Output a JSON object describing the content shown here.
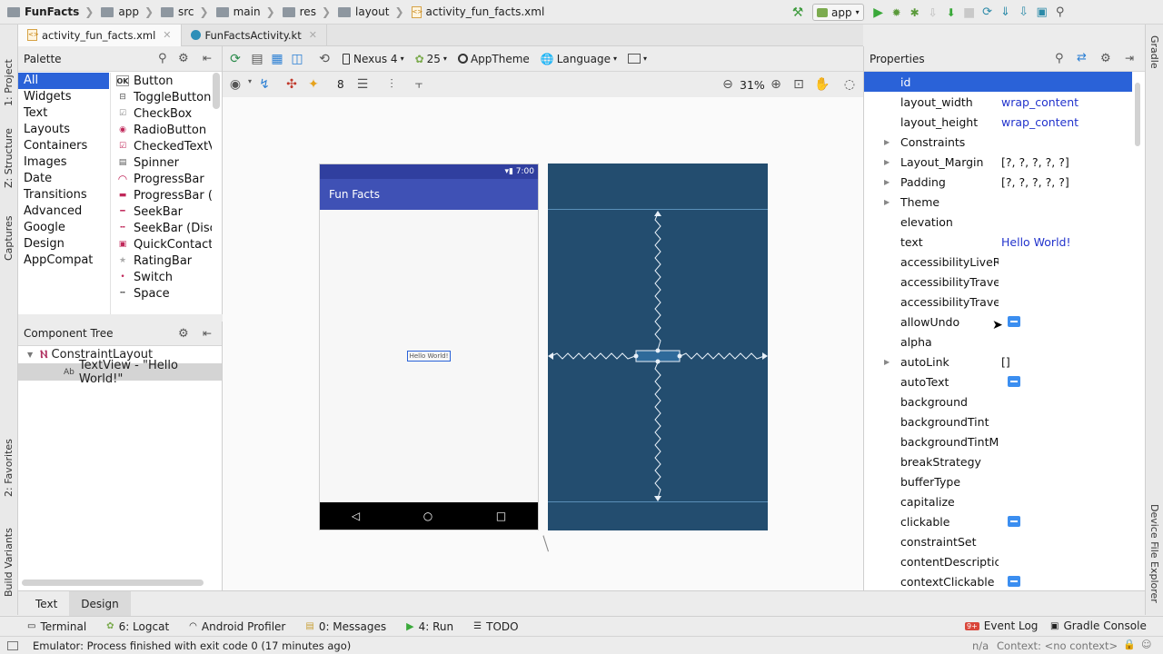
{
  "breadcrumbs": [
    "FunFacts",
    "app",
    "src",
    "main",
    "res",
    "layout",
    "activity_fun_facts.xml"
  ],
  "run_config": "app",
  "file_tabs": [
    {
      "label": "activity_fun_facts.xml",
      "active": true
    },
    {
      "label": "FunFactsActivity.kt",
      "active": false
    }
  ],
  "left_strip": {
    "project": "1: Project",
    "structure": "Z: Structure",
    "captures": "Captures",
    "favorites": "2: Favorites",
    "build_variants": "Build Variants"
  },
  "right_strip": {
    "gradle": "Gradle",
    "device_explorer": "Device File Explorer"
  },
  "palette": {
    "title": "Palette",
    "categories": [
      "All",
      "Widgets",
      "Text",
      "Layouts",
      "Containers",
      "Images",
      "Date",
      "Transitions",
      "Advanced",
      "Google",
      "Design",
      "AppCompat"
    ],
    "widgets": [
      "Button",
      "ToggleButton",
      "CheckBox",
      "RadioButton",
      "CheckedTextV",
      "Spinner",
      "ProgressBar",
      "ProgressBar (",
      "SeekBar",
      "SeekBar (Disc",
      "QuickContactB",
      "RatingBar",
      "Switch",
      "Space"
    ]
  },
  "component_tree": {
    "title": "Component Tree",
    "root": "ConstraintLayout",
    "child": "TextView - \"Hello World!\""
  },
  "design_toolbar": {
    "device": "Nexus 4",
    "api": "25",
    "theme": "AppTheme",
    "language": "Language",
    "margin": "8",
    "zoom": "31%"
  },
  "device_preview": {
    "status_time": "7:00",
    "app_title": "Fun Facts",
    "hello": "Hello World!"
  },
  "properties": {
    "title": "Properties",
    "rows": [
      {
        "name": "id",
        "value": "",
        "selected": true
      },
      {
        "name": "layout_width",
        "value": "wrap_content"
      },
      {
        "name": "layout_height",
        "value": "wrap_content"
      },
      {
        "name": "Constraints",
        "value": "",
        "expand": true
      },
      {
        "name": "Layout_Margin",
        "value": "[?, ?, ?, ?, ?]",
        "expand": true,
        "dark": true
      },
      {
        "name": "Padding",
        "value": "[?, ?, ?, ?, ?]",
        "expand": true,
        "dark": true
      },
      {
        "name": "Theme",
        "value": "",
        "expand": true
      },
      {
        "name": "elevation",
        "value": ""
      },
      {
        "name": "text",
        "value": "Hello World!"
      },
      {
        "name": "accessibilityLiveRe",
        "value": ""
      },
      {
        "name": "accessibilityTrave",
        "value": ""
      },
      {
        "name": "accessibilityTrave",
        "value": ""
      },
      {
        "name": "allowUndo",
        "value": "",
        "flag": true
      },
      {
        "name": "alpha",
        "value": ""
      },
      {
        "name": "autoLink",
        "value": "[]",
        "expand": true,
        "dark": true
      },
      {
        "name": "autoText",
        "value": "",
        "flag": true
      },
      {
        "name": "background",
        "value": ""
      },
      {
        "name": "backgroundTint",
        "value": ""
      },
      {
        "name": "backgroundTintM",
        "value": ""
      },
      {
        "name": "breakStrategy",
        "value": ""
      },
      {
        "name": "bufferType",
        "value": ""
      },
      {
        "name": "capitalize",
        "value": ""
      },
      {
        "name": "clickable",
        "value": "",
        "flag": true
      },
      {
        "name": "constraintSet",
        "value": ""
      },
      {
        "name": "contentDescriptic",
        "value": ""
      },
      {
        "name": "contextClickable",
        "value": "",
        "flag": true
      }
    ]
  },
  "design_tabs": [
    {
      "label": "Text",
      "active": false
    },
    {
      "label": "Design",
      "active": true
    }
  ],
  "tool_windows": [
    "Terminal",
    "6: Logcat",
    "Android Profiler",
    "0: Messages",
    "4: Run",
    "TODO"
  ],
  "tool_windows_right": [
    "Event Log",
    "Gradle Console"
  ],
  "event_badge": "9+",
  "status": {
    "message": "Emulator: Process finished with exit code 0 (17 minutes ago)",
    "na": "n/a",
    "context": "Context: <no context>"
  },
  "colors": {
    "accent": "#2a62d8",
    "app_bar": "#3f51b5",
    "blueprint": "#234d6f",
    "prop_value": "#2233cc",
    "flag": "#3b8ef0"
  }
}
